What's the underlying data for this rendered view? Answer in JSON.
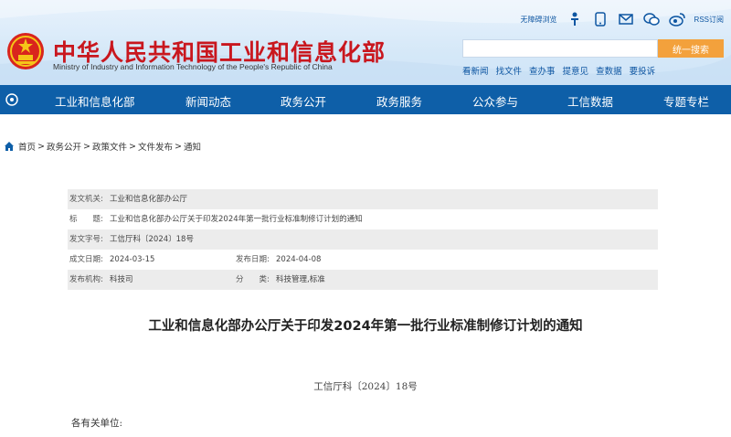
{
  "header": {
    "site_title": "中华人民共和国工业和信息化部",
    "site_subtitle": "Ministry of Industry and Information Technology of the People's Republic of China",
    "top_links": {
      "accessibility": "无障碍浏览",
      "rss": "RSS订阅"
    },
    "search": {
      "placeholder": "",
      "button": "统一搜索"
    },
    "quick_links": [
      "看新闻",
      "找文件",
      "查办事",
      "提意见",
      "查数据",
      "要投诉"
    ]
  },
  "nav": {
    "items": [
      "工业和信息化部",
      "新闻动态",
      "政务公开",
      "政务服务",
      "公众参与",
      "工信数据",
      "专题专栏"
    ]
  },
  "breadcrumb": [
    "首页",
    "政务公开",
    "政策文件",
    "文件发布",
    "通知"
  ],
  "meta": {
    "issuer_label": "发文机关:",
    "issuer": "工业和信息化部办公厅",
    "title_label": "标　　题:",
    "title": "工业和信息化部办公厅关于印发2024年第一批行业标准制修订计划的通知",
    "doc_no_label": "发文字号:",
    "doc_no": "工信厅科〔2024〕18号",
    "date_label": "成文日期:",
    "date": "2024-03-15",
    "publish_label": "发布日期:",
    "publish": "2024-04-08",
    "org_label": "发布机构:",
    "org": "科技司",
    "category_label": "分　　类:",
    "category": "科技管理,标准"
  },
  "article": {
    "title": "工业和信息化部办公厅关于印发2024年第一批行业标准制修订计划的通知",
    "doc_no": "工信厅科〔2024〕18号",
    "salutation": "各有关单位:"
  },
  "colors": {
    "nav_bg": "#0e5fa8",
    "brand_red": "#c9171e",
    "search_button": "#f3a13c",
    "link_blue": "#0e56a2"
  }
}
